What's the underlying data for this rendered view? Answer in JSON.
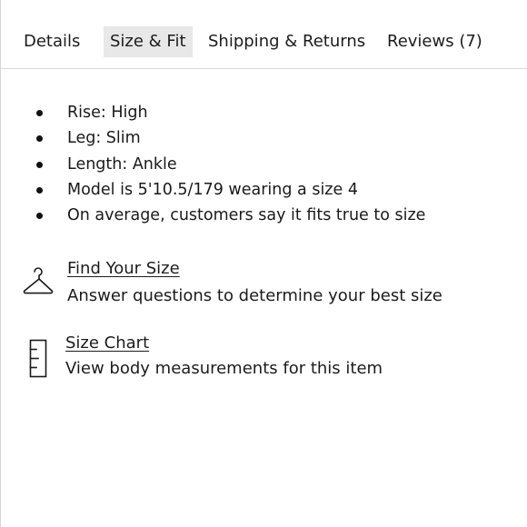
{
  "tabs": [
    {
      "label": "Details",
      "active": false
    },
    {
      "label": "Size & Fit",
      "active": true
    },
    {
      "label": "Shipping & Returns",
      "active": false
    },
    {
      "label": "Reviews (7)",
      "active": false
    }
  ],
  "fit_details": [
    "Rise: High",
    "Leg: Slim",
    "Length: Ankle",
    "Model is 5'10.5/179 wearing a size 4",
    "On average, customers say it fits true to size"
  ],
  "find_your_size": {
    "icon": "hanger-icon",
    "link_label": "Find Your Size",
    "description": "Answer questions to determine your best size"
  },
  "size_chart": {
    "icon": "ruler-icon",
    "link_label": "Size Chart",
    "description": "View body measurements for this item"
  },
  "colors": {
    "text": "#1c1c1c",
    "active_tab_bg": "#e8e8e8",
    "divider": "#d9d9d9"
  }
}
